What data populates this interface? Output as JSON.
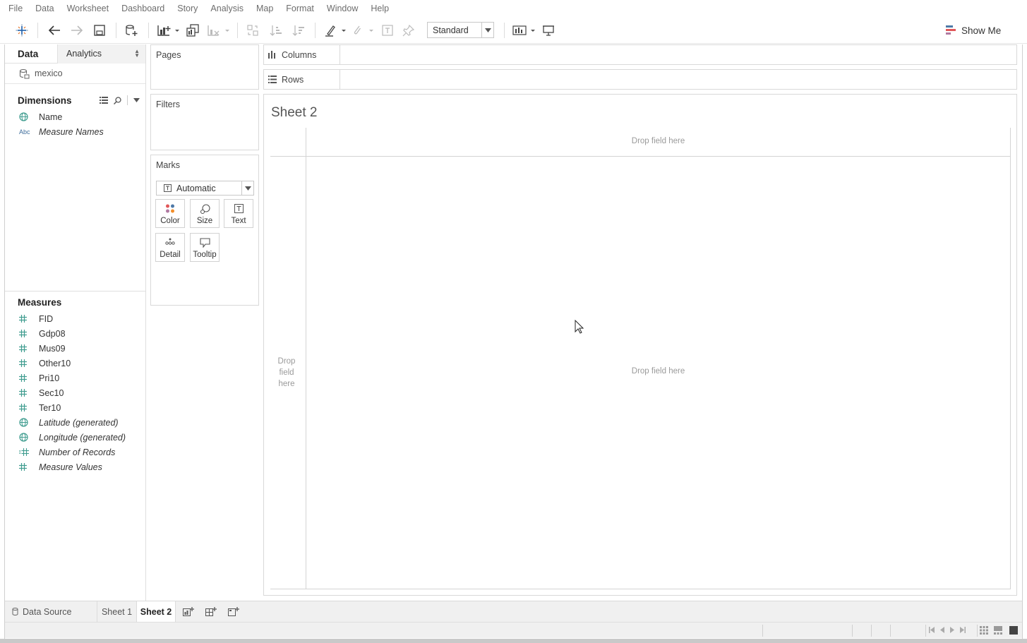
{
  "menu": [
    "File",
    "Data",
    "Worksheet",
    "Dashboard",
    "Story",
    "Analysis",
    "Map",
    "Format",
    "Window",
    "Help"
  ],
  "toolbar": {
    "fit_select": "Standard",
    "show_me": "Show Me"
  },
  "data_pane": {
    "tab_data": "Data",
    "tab_analytics": "Analytics",
    "datasource": "mexico",
    "dimensions_label": "Dimensions",
    "dimensions": [
      {
        "type": "globe",
        "name": "Name",
        "italic": false
      },
      {
        "type": "abc",
        "name": "Measure Names",
        "italic": true
      }
    ],
    "abc_label": "Abc",
    "measures_label": "Measures",
    "measures": [
      {
        "type": "hash",
        "name": "FID",
        "italic": false
      },
      {
        "type": "hash",
        "name": "Gdp08",
        "italic": false
      },
      {
        "type": "hash",
        "name": "Mus09",
        "italic": false
      },
      {
        "type": "hash",
        "name": "Other10",
        "italic": false
      },
      {
        "type": "hash",
        "name": "Pri10",
        "italic": false
      },
      {
        "type": "hash",
        "name": "Sec10",
        "italic": false
      },
      {
        "type": "hash",
        "name": "Ter10",
        "italic": false
      },
      {
        "type": "globe",
        "name": "Latitude (generated)",
        "italic": true
      },
      {
        "type": "globe",
        "name": "Longitude (generated)",
        "italic": true
      },
      {
        "type": "hash-eq",
        "name": "Number of Records",
        "italic": true
      },
      {
        "type": "hash",
        "name": "Measure Values",
        "italic": true
      }
    ]
  },
  "cards": {
    "pages": "Pages",
    "filters": "Filters",
    "marks": "Marks",
    "mark_type": "Automatic",
    "mark_buttons": {
      "color": "Color",
      "size": "Size",
      "text": "Text",
      "detail": "Detail",
      "tooltip": "Tooltip"
    }
  },
  "shelves": {
    "columns": "Columns",
    "rows": "Rows"
  },
  "view": {
    "sheet_title": "Sheet 2",
    "drop_top": "Drop field here",
    "drop_left": "Drop field here",
    "drop_center": "Drop field here"
  },
  "bottom_tabs": {
    "data_source": "Data Source",
    "sheet1": "Sheet 1",
    "sheet2": "Sheet 2"
  },
  "colors": {
    "field_icon": "#3f9c8f",
    "tableau_blue": "#1f5fa8",
    "tableau_orange": "#e8762b"
  }
}
